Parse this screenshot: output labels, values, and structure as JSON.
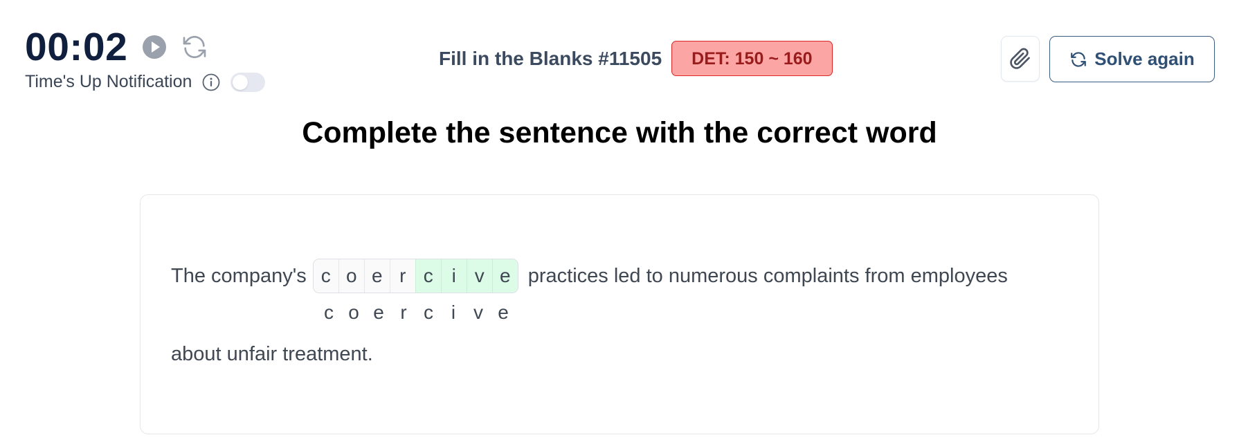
{
  "timer": {
    "display": "00:02"
  },
  "notification": {
    "label": "Time's Up Notification",
    "enabled": false
  },
  "header": {
    "title": "Fill in the Blanks #11505",
    "badge": "DET: 150 ~ 160"
  },
  "actions": {
    "solve_again_label": "Solve again"
  },
  "question": {
    "heading": "Complete the sentence with the correct word",
    "before": "The company's",
    "after": "practices led to numerous complaints from employees",
    "end": "about unfair treatment.",
    "letters": [
      {
        "char": "c",
        "filled": false
      },
      {
        "char": "o",
        "filled": false
      },
      {
        "char": "e",
        "filled": false
      },
      {
        "char": "r",
        "filled": false
      },
      {
        "char": "c",
        "filled": true
      },
      {
        "char": "i",
        "filled": true
      },
      {
        "char": "v",
        "filled": true
      },
      {
        "char": "e",
        "filled": true
      }
    ],
    "answer_letters": [
      "c",
      "o",
      "e",
      "r",
      "c",
      "i",
      "v",
      "e"
    ]
  },
  "icons": [
    "play-icon",
    "refresh-icon",
    "info-icon",
    "paperclip-icon",
    "solve-again-icon"
  ],
  "colors": {
    "badge_bg": "#fca5a5",
    "badge_border": "#dc2626",
    "badge_text": "#991b1b",
    "filled_cell": "#dcfce7",
    "primary_text": "#0f1f3d",
    "solve_border": "#3b5a80"
  }
}
